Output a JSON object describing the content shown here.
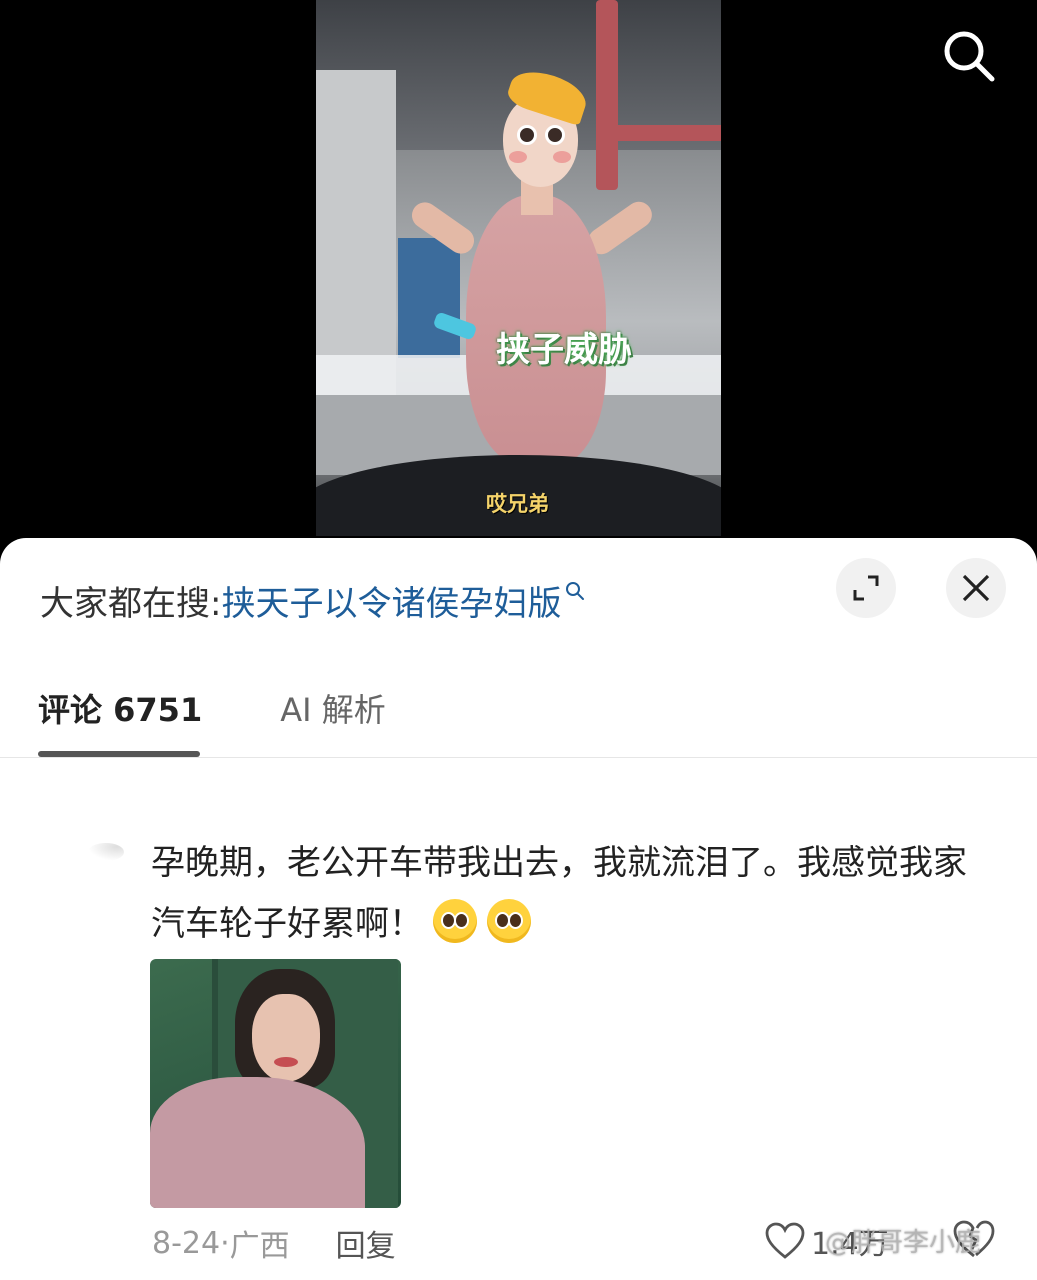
{
  "video": {
    "caption_main": "挟子威胁",
    "caption_sub": "哎兄弟"
  },
  "search_bar": {
    "label": "大家都在搜:",
    "query": "挟天子以令诸侯孕妇版"
  },
  "tabs": {
    "comments_label": "评论 6751",
    "ai_label": "AI 解析"
  },
  "comment": {
    "text": "孕晚期，老公开车带我出去，我就流泪了。我感觉我家汽车轮子好累啊！",
    "emoji_count": 2,
    "date": "8-24",
    "location": "广西",
    "reply_label": "回复",
    "like_count": "1.4万"
  },
  "watermark": "@胖哥李小鹿"
}
